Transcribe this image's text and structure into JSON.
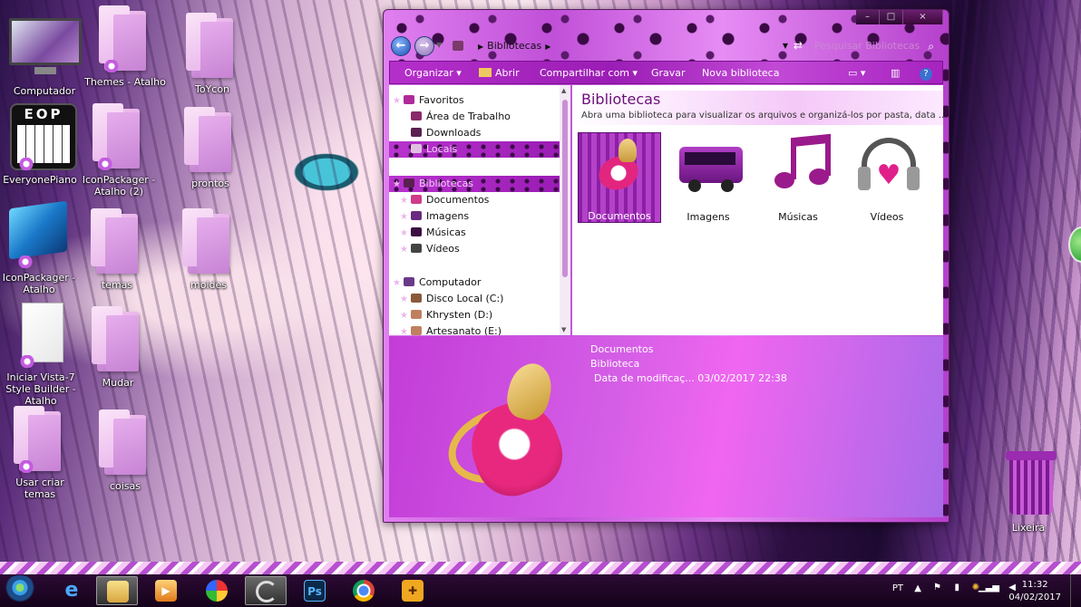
{
  "desktop": {
    "icons": [
      {
        "label": "Computador"
      },
      {
        "label": "Themes - Atalho"
      },
      {
        "label": "ToYcon"
      },
      {
        "label": "EveryonePiano"
      },
      {
        "label": "IconPackager - Atalho (2)"
      },
      {
        "label": "prontos"
      },
      {
        "label": "IconPackager - Atalho"
      },
      {
        "label": "temas"
      },
      {
        "label": "moldes"
      },
      {
        "label": "Iniciar Vista-7 Style Builder - Atalho"
      },
      {
        "label": "Mudar"
      },
      {
        "label": "Usar criar temas"
      },
      {
        "label": "coisas"
      },
      {
        "label": "Lixeira"
      }
    ],
    "eop_text": "EOP"
  },
  "window": {
    "address": {
      "segment": "Bibliotecas"
    },
    "search_placeholder": "Pesquisar Bibliotecas",
    "toolbar": {
      "organize": "Organizar",
      "open": "Abrir",
      "share": "Compartilhar com",
      "burn": "Gravar",
      "new_library": "Nova biblioteca"
    },
    "nav": {
      "favorites": "Favoritos",
      "desktop": "Área de Trabalho",
      "downloads": "Downloads",
      "places": "Locais",
      "libraries": "Bibliotecas",
      "documents": "Documentos",
      "images": "Imagens",
      "music": "Músicas",
      "videos": "Vídeos",
      "computer": "Computador",
      "disk_c": "Disco Local (C:)",
      "disk_d": "Khrysten (D:)",
      "disk_e": "Artesanato (E:)"
    },
    "content": {
      "title": "Bibliotecas",
      "subtitle": "Abra uma biblioteca para visualizar os arquivos e organizá-los por pasta, data ...",
      "items": [
        {
          "label": "Documentos"
        },
        {
          "label": "Imagens"
        },
        {
          "label": "Músicas"
        },
        {
          "label": "Vídeos"
        }
      ]
    },
    "details": {
      "name": "Documentos",
      "type": "Biblioteca",
      "modified": "Data de modificaç... 03/02/2017 22:38"
    }
  },
  "taskbar": {
    "language": "PT",
    "time": "11:32",
    "date": "04/02/2017",
    "ps_label": "Ps"
  },
  "colors": {
    "accent": "#b52fcb",
    "taskbar": "#1c0624",
    "title_text": "#6b0f78"
  }
}
